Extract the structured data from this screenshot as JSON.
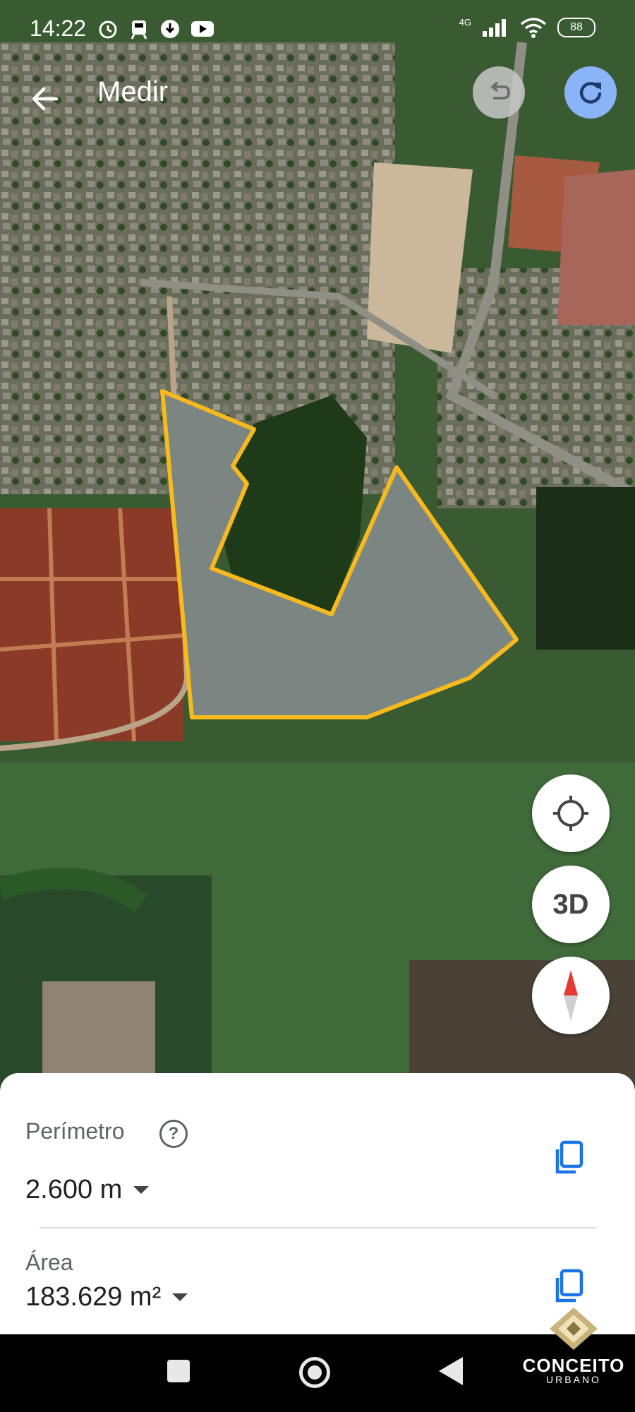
{
  "status_bar": {
    "time": "14:22",
    "network": "4G",
    "battery": "88",
    "left_icons": [
      "alarm-icon",
      "train-icon",
      "download-icon",
      "youtube-icon"
    ],
    "right_icons": [
      "signal-icon",
      "wifi-icon",
      "battery-icon"
    ]
  },
  "header": {
    "title": "Medir",
    "back_icon": "arrow-left-icon",
    "undo_icon": "undo-icon",
    "redo_icon": "redo-icon"
  },
  "map_controls": {
    "locate_icon": "crosshair-icon",
    "three_d_label": "3D",
    "compass_icon": "compass-icon"
  },
  "measurement": {
    "perimeter_label": "Perímetro",
    "perimeter_value": "2.600 m",
    "area_label": "Área",
    "area_value": "183.629 m²",
    "help_icon": "help-icon",
    "copy_icon": "copy-icon"
  },
  "watermark": {
    "brand": "CONCEITO",
    "sub": "URBANO"
  },
  "colors": {
    "polygon_outline": "#f6b91e",
    "accent_blue": "#1a73e8",
    "redo_button": "#8ab4f8"
  }
}
